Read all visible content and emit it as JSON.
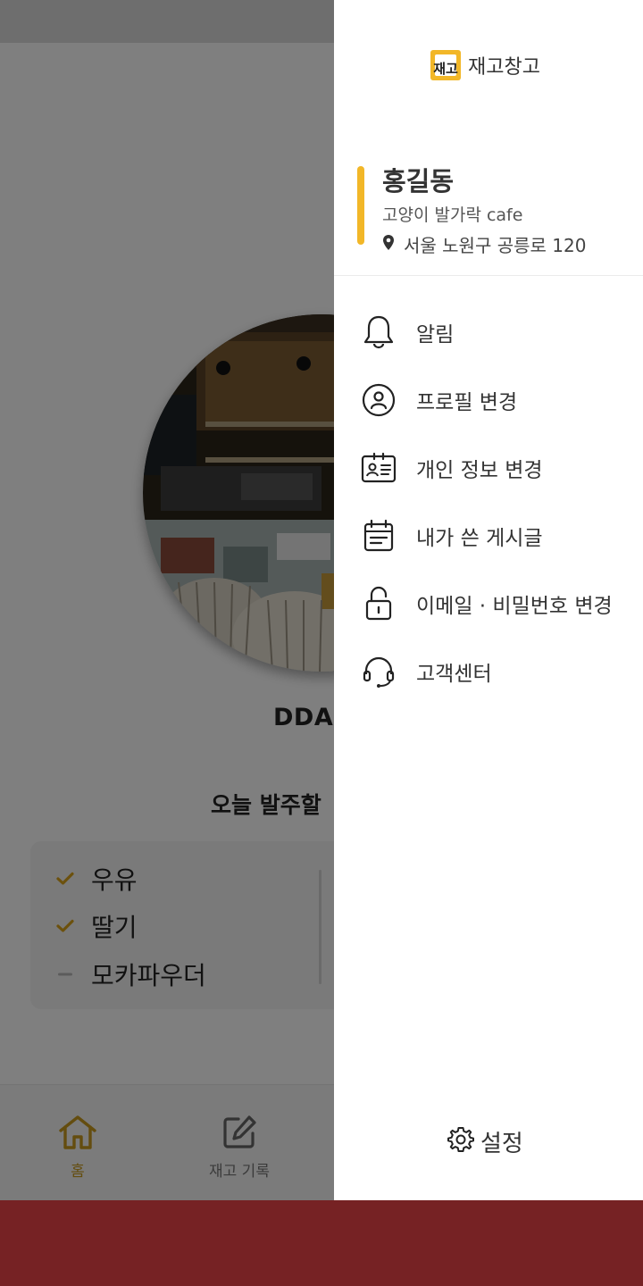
{
  "home": {
    "cafe_title": "DDAI",
    "order_section_title": "오늘 발주할",
    "order_items": [
      {
        "label": "우유",
        "status": "checked"
      },
      {
        "label": "딸기",
        "status": "checked"
      },
      {
        "label": "모카파우더",
        "status": "unchecked"
      }
    ],
    "bottom_nav": [
      {
        "label": "홈",
        "icon": "home-icon",
        "active": true
      },
      {
        "label": "재고 기록",
        "icon": "edit-icon",
        "active": false
      }
    ]
  },
  "drawer": {
    "brand_logo_text": "재고",
    "brand_name": "재고창고",
    "profile": {
      "name": "홍길동",
      "shop": "고양이 발가락 cafe",
      "address": "서울 노원구 공릉로 120"
    },
    "menu": [
      {
        "label": "알림",
        "icon": "bell-icon"
      },
      {
        "label": "프로필 변경",
        "icon": "user-circle-icon"
      },
      {
        "label": "개인 정보 변경",
        "icon": "id-card-icon"
      },
      {
        "label": "내가 쓴 게시글",
        "icon": "calendar-note-icon"
      },
      {
        "label": "이메일 · 비밀번호 변경",
        "icon": "unlock-icon"
      },
      {
        "label": "고객센터",
        "icon": "headset-icon"
      }
    ],
    "settings_label": "설정"
  },
  "colors": {
    "accent": "#f2b728",
    "nav_active": "#c89a1e",
    "check": "#d9a21b",
    "system_bar": "#762224"
  }
}
